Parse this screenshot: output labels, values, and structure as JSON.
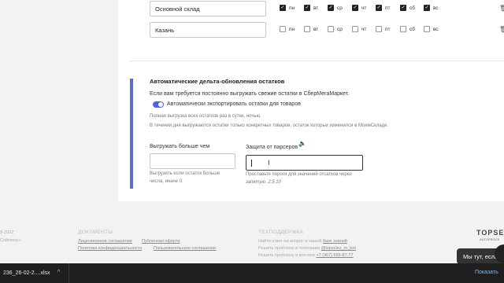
{
  "warehouses": [
    {
      "name": "Основной склад",
      "days": [
        {
          "label": "пн",
          "checked": true
        },
        {
          "label": "вт",
          "checked": true
        },
        {
          "label": "ср",
          "checked": true
        },
        {
          "label": "чт",
          "checked": true
        },
        {
          "label": "пт",
          "checked": true
        },
        {
          "label": "сб",
          "checked": true
        },
        {
          "label": "вс",
          "checked": true
        }
      ]
    },
    {
      "name": "Казань",
      "days": [
        {
          "label": "пн",
          "checked": false
        },
        {
          "label": "вт",
          "checked": false
        },
        {
          "label": "ср",
          "checked": false
        },
        {
          "label": "чт",
          "checked": false
        },
        {
          "label": "пт",
          "checked": false
        },
        {
          "label": "сб",
          "checked": false
        },
        {
          "label": "вс",
          "checked": false
        }
      ]
    }
  ],
  "section": {
    "title": "Автоматические дельта-обновления остатков",
    "intro": "Если вам требуется постоянно выгружать свежие остатки в СберМегаМаркет.",
    "toggle_label": "Автоматически экспортировать остатки для товаров",
    "toggle_on": true,
    "note1": "Полная выгрузка всех остатков раз в сутки, ночью.",
    "note2": "В течении дня выгружаются остатки только конкретных товаров, остаток которых изменился в МоемСкладе.",
    "field1_label": "Выгружать больше чем",
    "field1_value": "",
    "field1_help1": "Выгрузить если остаток больше",
    "field1_help2": "числа, иначе 0.",
    "field2_label": "Защита от парсеров",
    "field2_value": "",
    "field2_help1": "Проставьте пороги для значений отсатков через",
    "field2_help2": "запятую. 2,5,10"
  },
  "footer": {
    "copy_year": "9-2022",
    "copy_name": "Сэйптекс»",
    "docs_head": "ДОКУМЕНТЫ",
    "docs_links": [
      "Лицензионное соглашение",
      "Публичная оферта",
      "Политика конфиденциальности",
      "Пользовательское соглашение"
    ],
    "support_head": "ТЕХПОДДЕРЖКА",
    "support_line1": "Найти ответ на вопрос в нашей",
    "support_link1": "базе знаний",
    "support_line2": "Решить проблему в телеграме",
    "support_link2": "@topsclez_m_bot",
    "support_line3": "Решить проблему в вотсапе",
    "support_link3": "+7 (967) 555-87-77",
    "brand": "TOPSE",
    "brand_sub": "AUTOPROCE"
  },
  "chat": {
    "label": "Мы тут, если что"
  },
  "downloads": {
    "file": "236_26-02-2....xlsx",
    "show_all": "Показать"
  },
  "colors": {
    "accent": "#4a63e0",
    "bar": "#5b6bd6"
  }
}
